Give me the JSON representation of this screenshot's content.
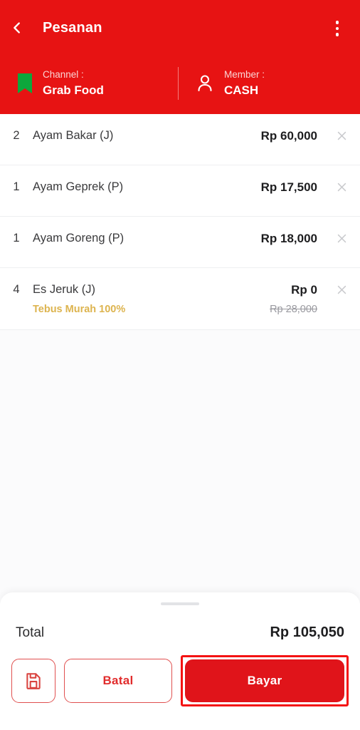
{
  "header": {
    "title": "Pesanan",
    "back_icon": "chevron-left-icon",
    "menu_icon": "kebab-menu-icon",
    "brand_color": "#e71313",
    "channel": {
      "label": "Channel :",
      "value": "Grab Food",
      "icon": "bookmark-icon",
      "icon_color": "#0da73c"
    },
    "member": {
      "label": "Member :",
      "value": "CASH",
      "icon": "person-icon"
    }
  },
  "order": {
    "remove_icon": "close-x-icon",
    "items": [
      {
        "qty": "2",
        "name": "Ayam Bakar (J)",
        "price": "Rp 60,000",
        "promo": "",
        "price_old": ""
      },
      {
        "qty": "1",
        "name": "Ayam Geprek (P)",
        "price": "Rp 17,500",
        "promo": "",
        "price_old": ""
      },
      {
        "qty": "1",
        "name": "Ayam Goreng (P)",
        "price": "Rp 18,000",
        "promo": "",
        "price_old": ""
      },
      {
        "qty": "4",
        "name": "Es Jeruk (J)",
        "price": "Rp 0",
        "promo": "Tebus Murah 100%",
        "promo_color": "#ddb44f",
        "price_old": "Rp 28,000"
      }
    ]
  },
  "footer": {
    "total_label": "Total",
    "total_value": "Rp 105,050",
    "save_icon": "floppy-disk-save-icon",
    "cancel_label": "Batal",
    "pay_label": "Bayar",
    "pay_highlight_color": "#f41212"
  }
}
